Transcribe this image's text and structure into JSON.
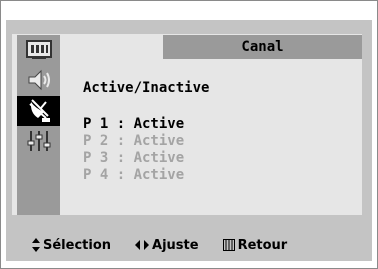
{
  "menu": {
    "title": "Canal",
    "heading": "Active/Inactive",
    "programs": [
      {
        "label": "P 1 : Active",
        "state": "selected"
      },
      {
        "label": "P 2 : Active",
        "state": "dim"
      },
      {
        "label": "P 3 : Active",
        "state": "dim"
      },
      {
        "label": "P 4 : Active",
        "state": "dim"
      }
    ]
  },
  "sidebar": {
    "icons": [
      "picture-icon",
      "sound-icon",
      "channel-antenna-icon",
      "setup-sliders-icon"
    ],
    "selected": "channel-antenna-icon"
  },
  "footer": {
    "select_label": "Sélection",
    "adjust_label": "Ajuste",
    "return_label": "Retour"
  }
}
